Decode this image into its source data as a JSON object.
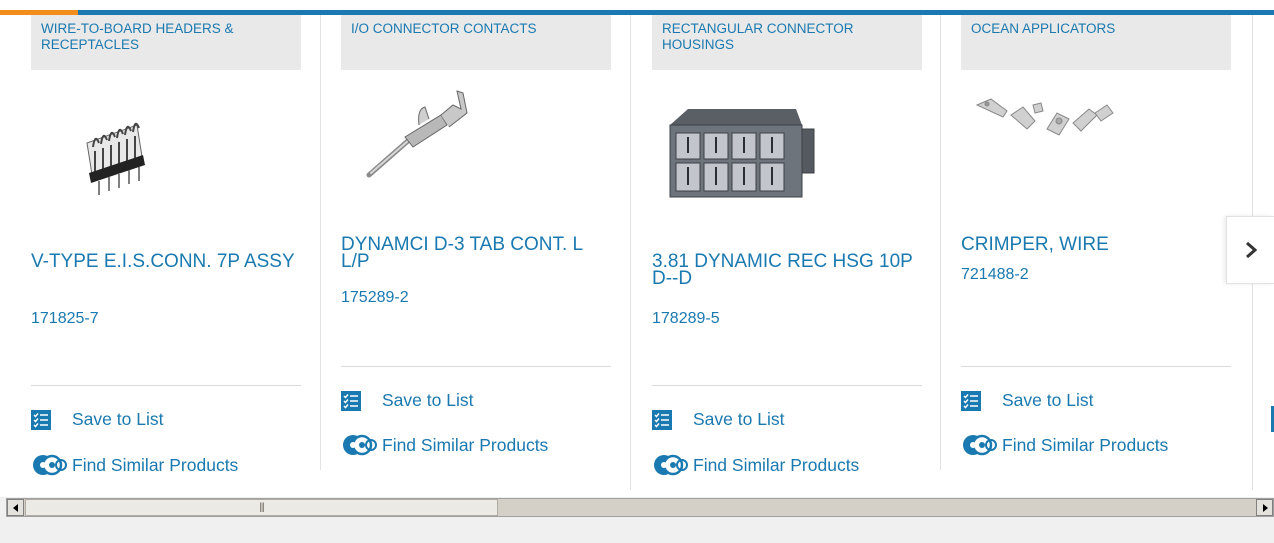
{
  "colors": {
    "link": "#1a79b0",
    "accent": "#f28c1b",
    "category_bg": "#e9e9e9"
  },
  "products": [
    {
      "category": "WIRE-TO-BOARD HEADERS & RECEPTACLES",
      "title": "V-TYPE E.I.S.CONN. 7P ASSY",
      "part_number": "171825-7",
      "save_label": "Save to List",
      "similar_label": "Find Similar Products",
      "image_icon": "header-connector-image"
    },
    {
      "category": "I/O CONNECTOR CONTACTS",
      "title": "DYNAMCI D-3 TAB CONT. L L/P",
      "part_number": "175289-2",
      "save_label": "Save to List",
      "similar_label": "Find Similar Products",
      "image_icon": "tab-contact-image"
    },
    {
      "category": "RECTANGULAR CONNECTOR HOUSINGS",
      "title": "3.81 DYNAMIC REC HSG 10P D--D",
      "part_number": "178289-5",
      "save_label": "Save to List",
      "similar_label": "Find Similar Products",
      "image_icon": "connector-housing-image"
    },
    {
      "category": "OCEAN APPLICATORS",
      "title": "CRIMPER, WIRE",
      "part_number": "721488-2",
      "save_label": "Save to List",
      "similar_label": "Find Similar Products",
      "image_icon": "crimper-parts-image"
    }
  ],
  "carousel": {
    "next_icon": "chevron-right-icon"
  },
  "scrollbar": {
    "left_icon": "arrow-left-icon",
    "right_icon": "arrow-right-icon",
    "grip": "|||"
  }
}
